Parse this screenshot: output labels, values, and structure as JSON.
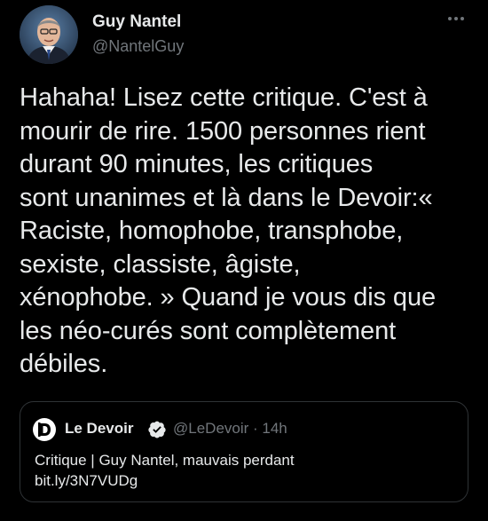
{
  "tweet": {
    "author": {
      "name": "Guy Nantel",
      "handle": "@NantelGuy"
    },
    "text": "Hahaha! Lisez cette critique. C'est à\nmourir de rire. 1500 personnes rient\ndurant 90 minutes, les critiques\nsont unanimes et là dans le Devoir:«\nRaciste, homophobe, transphobe,\nsexiste, classiste, âgiste,\nxénophobe. » Quand je vous dis que\nles néo-curés sont complètement\ndébiles.",
    "more_icon": "more-horizontal-icon"
  },
  "quote": {
    "logo_icon": "le-devoir-logo-icon",
    "name": "Le Devoir",
    "verified_icon": "verified-badge-icon",
    "handle_time": "@LeDevoir · 14h",
    "text": "Critique | Guy Nantel, mauvais perdant\nbit.ly/3N7VUDg"
  },
  "colors": {
    "background": "#000000",
    "text_primary": "#e7e9ea",
    "text_secondary": "#71767b",
    "border": "#2f3336"
  }
}
